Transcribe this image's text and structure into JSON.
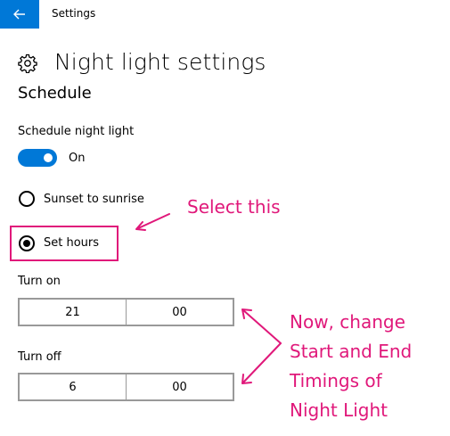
{
  "titlebar": {
    "title": "Settings",
    "back_icon": "back-arrow-icon"
  },
  "page": {
    "title": "Night light settings",
    "icon": "gear-icon"
  },
  "schedule": {
    "heading": "Schedule",
    "toggle_label": "Schedule night light",
    "toggle_state": "On",
    "toggle_on": true,
    "options": [
      {
        "label": "Sunset to sunrise",
        "selected": false
      },
      {
        "label": "Set hours",
        "selected": true
      }
    ],
    "turn_on": {
      "label": "Turn on",
      "hour": "21",
      "minute": "00"
    },
    "turn_off": {
      "label": "Turn off",
      "hour": "6",
      "minute": "00"
    }
  },
  "annotations": {
    "select": "Select this",
    "note_lines": [
      "Now, change",
      "Start and End",
      "Timings of",
      "Night Light"
    ],
    "color": "#e0187a"
  },
  "colors": {
    "accent": "#0078d7"
  }
}
